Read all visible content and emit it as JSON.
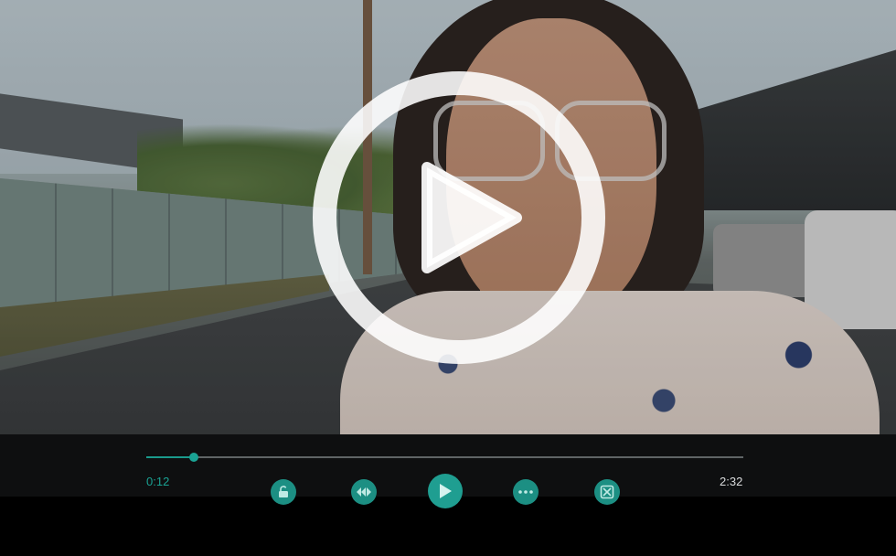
{
  "player": {
    "current_time": "0:12",
    "duration": "2:32",
    "progress": 0.08,
    "accent_color": "#1aa394"
  },
  "overlay": {
    "icon": "play-icon"
  },
  "controls": {
    "buttons": [
      {
        "name": "lock-button",
        "icon": "lock-icon"
      },
      {
        "name": "rewind-forward-button",
        "icon": "seek-arrows-icon"
      },
      {
        "name": "play-button",
        "icon": "play-icon"
      },
      {
        "name": "more-button",
        "icon": "more-dots-icon"
      },
      {
        "name": "screen-mode-button",
        "icon": "fit-screen-icon"
      }
    ]
  }
}
